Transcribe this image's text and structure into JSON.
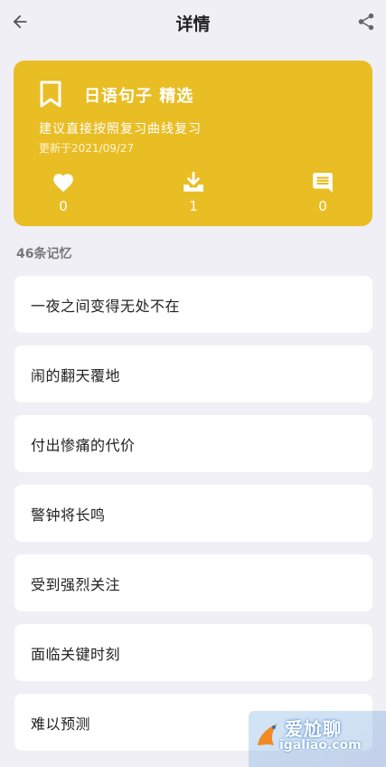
{
  "header": {
    "title": "详情",
    "back_icon": "arrow-left-icon",
    "share_icon": "share-icon"
  },
  "deck": {
    "icon": "bookmark-icon",
    "title": "日语句子 精选",
    "subtitle": "建议直接按照复习曲线复习",
    "updated": "更新于2021/09/27",
    "color": "#e9bd24",
    "stats": {
      "likes": "0",
      "downloads": "1",
      "comments": "0"
    }
  },
  "memory_count": "46条记忆",
  "items": [
    {
      "text": "一夜之间变得无处不在"
    },
    {
      "text": "闹的翻天覆地"
    },
    {
      "text": "付出惨痛的代价"
    },
    {
      "text": "警钟将长鸣"
    },
    {
      "text": "受到强烈关注"
    },
    {
      "text": "面临关键时刻"
    },
    {
      "text": "难以预测"
    }
  ],
  "watermark": {
    "main": "爱尬聊",
    "url": "igaliao.com"
  }
}
